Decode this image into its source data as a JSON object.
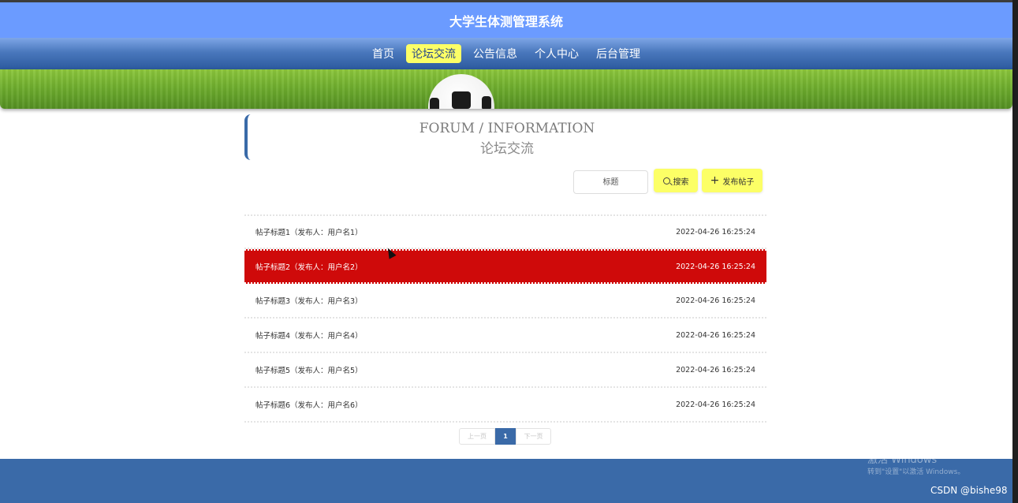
{
  "header": {
    "title": "大学生体测管理系统"
  },
  "nav": {
    "items": [
      {
        "label": "首页",
        "active": false
      },
      {
        "label": "论坛交流",
        "active": true
      },
      {
        "label": "公告信息",
        "active": false
      },
      {
        "label": "个人中心",
        "active": false
      },
      {
        "label": "后台管理",
        "active": false
      }
    ]
  },
  "section": {
    "title_en": "FORUM / INFORMATION",
    "title_cn": "论坛交流"
  },
  "search": {
    "placeholder": "标题",
    "search_label": "搜索",
    "post_label": "发布帖子"
  },
  "posts": [
    {
      "title": "帖子标题1（发布人：用户名1）",
      "time": "2022-04-26 16:25:24"
    },
    {
      "title": "帖子标题2（发布人：用户名2）",
      "time": "2022-04-26 16:25:24",
      "highlighted": true
    },
    {
      "title": "帖子标题3（发布人：用户名3）",
      "time": "2022-04-26 16:25:24"
    },
    {
      "title": "帖子标题4（发布人：用户名4）",
      "time": "2022-04-26 16:25:24"
    },
    {
      "title": "帖子标题5（发布人：用户名5）",
      "time": "2022-04-26 16:25:24"
    },
    {
      "title": "帖子标题6（发布人：用户名6）",
      "time": "2022-04-26 16:25:24"
    }
  ],
  "pagination": {
    "prev": "上一页",
    "current": "1",
    "next": "下一页"
  },
  "watermark": {
    "line1": "激活 Windows",
    "line2": "转到\"设置\"以激活 Windows。",
    "credit": "CSDN @bishe98"
  },
  "colors": {
    "header": "#6b9bff",
    "primary": "#3a6aa8",
    "accent": "#fcff66",
    "highlight_row": "#cf0a0a"
  },
  "icons": {
    "search": "search-icon",
    "add": "plus-icon"
  }
}
